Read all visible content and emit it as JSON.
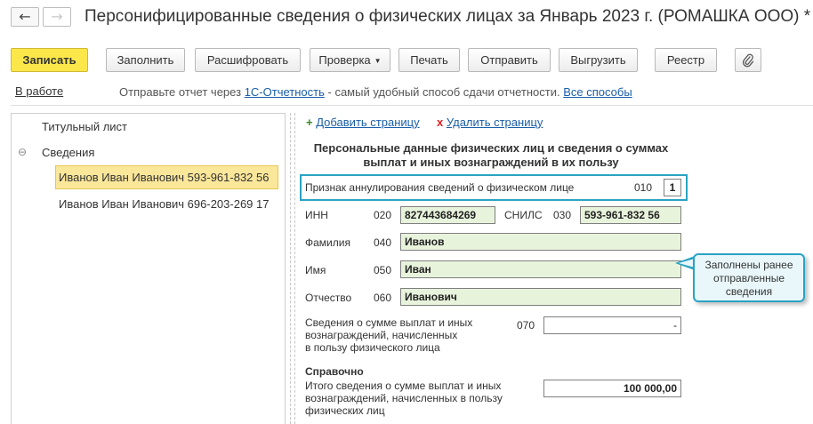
{
  "window": {
    "title": "Персонифицированные сведения о физических лицах за Январь 2023 г. (РОМАШКА ООО) *",
    "back_glyph": "←",
    "forward_glyph": "→"
  },
  "toolbar": {
    "save": "Записать",
    "fill": "Заполнить",
    "decode": "Расшифровать",
    "check": "Проверка",
    "print": "Печать",
    "send": "Отправить",
    "export": "Выгрузить",
    "registry": "Реестр",
    "attach_icon": "paperclip-icon"
  },
  "status": {
    "state": "В работе",
    "msg_prefix": "Отправьте отчет через",
    "msg_link": "1С-Отчетность",
    "msg_suffix": "- самый удобный способ сдачи отчетности.",
    "all_methods": "Все способы"
  },
  "tree": {
    "title_page": "Титульный лист",
    "group_toggle": "⊖",
    "group": "Сведения",
    "items": [
      "Иванов Иван Иванович 593-961-832 56",
      "Иванов Иван Иванович 696-203-269 17"
    ]
  },
  "page_actions": {
    "add_icon": "+",
    "add": "Добавить страницу",
    "delete_icon": "x",
    "delete": "Удалить страницу"
  },
  "form": {
    "heading_line1": "Персональные данные физических лиц и сведения о суммах",
    "heading_line2": "выплат и иных вознаграждений в их пользу",
    "annul_label": "Признак аннулирования сведений о физическом лице",
    "annul_code": "010",
    "annul_value": "1",
    "inn_label": "ИНН",
    "inn_code": "020",
    "inn_value": "827443684269",
    "snils_label": "СНИЛС",
    "snils_code": "030",
    "snils_value": "593-961-832 56",
    "surname_label": "Фамилия",
    "surname_code": "040",
    "surname_value": "Иванов",
    "name_label": "Имя",
    "name_code": "050",
    "name_value": "Иван",
    "patronymic_label": "Отчество",
    "patronymic_code": "060",
    "patronymic_value": "Иванович",
    "payments_label_1": "Сведения о сумме выплат и иных",
    "payments_label_2": "вознаграждений, начисленных",
    "payments_label_3": "в пользу физического лица",
    "payments_code": "070",
    "payments_value": "-",
    "ref_heading": "Справочно",
    "total_label_1": "Итого сведения о сумме выплат и иных",
    "total_label_2": "вознаграждений, начисленных в пользу",
    "total_label_3": "физических лиц",
    "total_value": "100 000,00"
  },
  "callout": {
    "line1": "Заполнены ранее",
    "line2": "отправленные",
    "line3": "сведения"
  },
  "colors": {
    "accent_yellow": "#fbe74a",
    "highlight_blue": "#2aa3c3",
    "field_green": "#e8f3dc",
    "link_blue": "#1a5ea8"
  }
}
